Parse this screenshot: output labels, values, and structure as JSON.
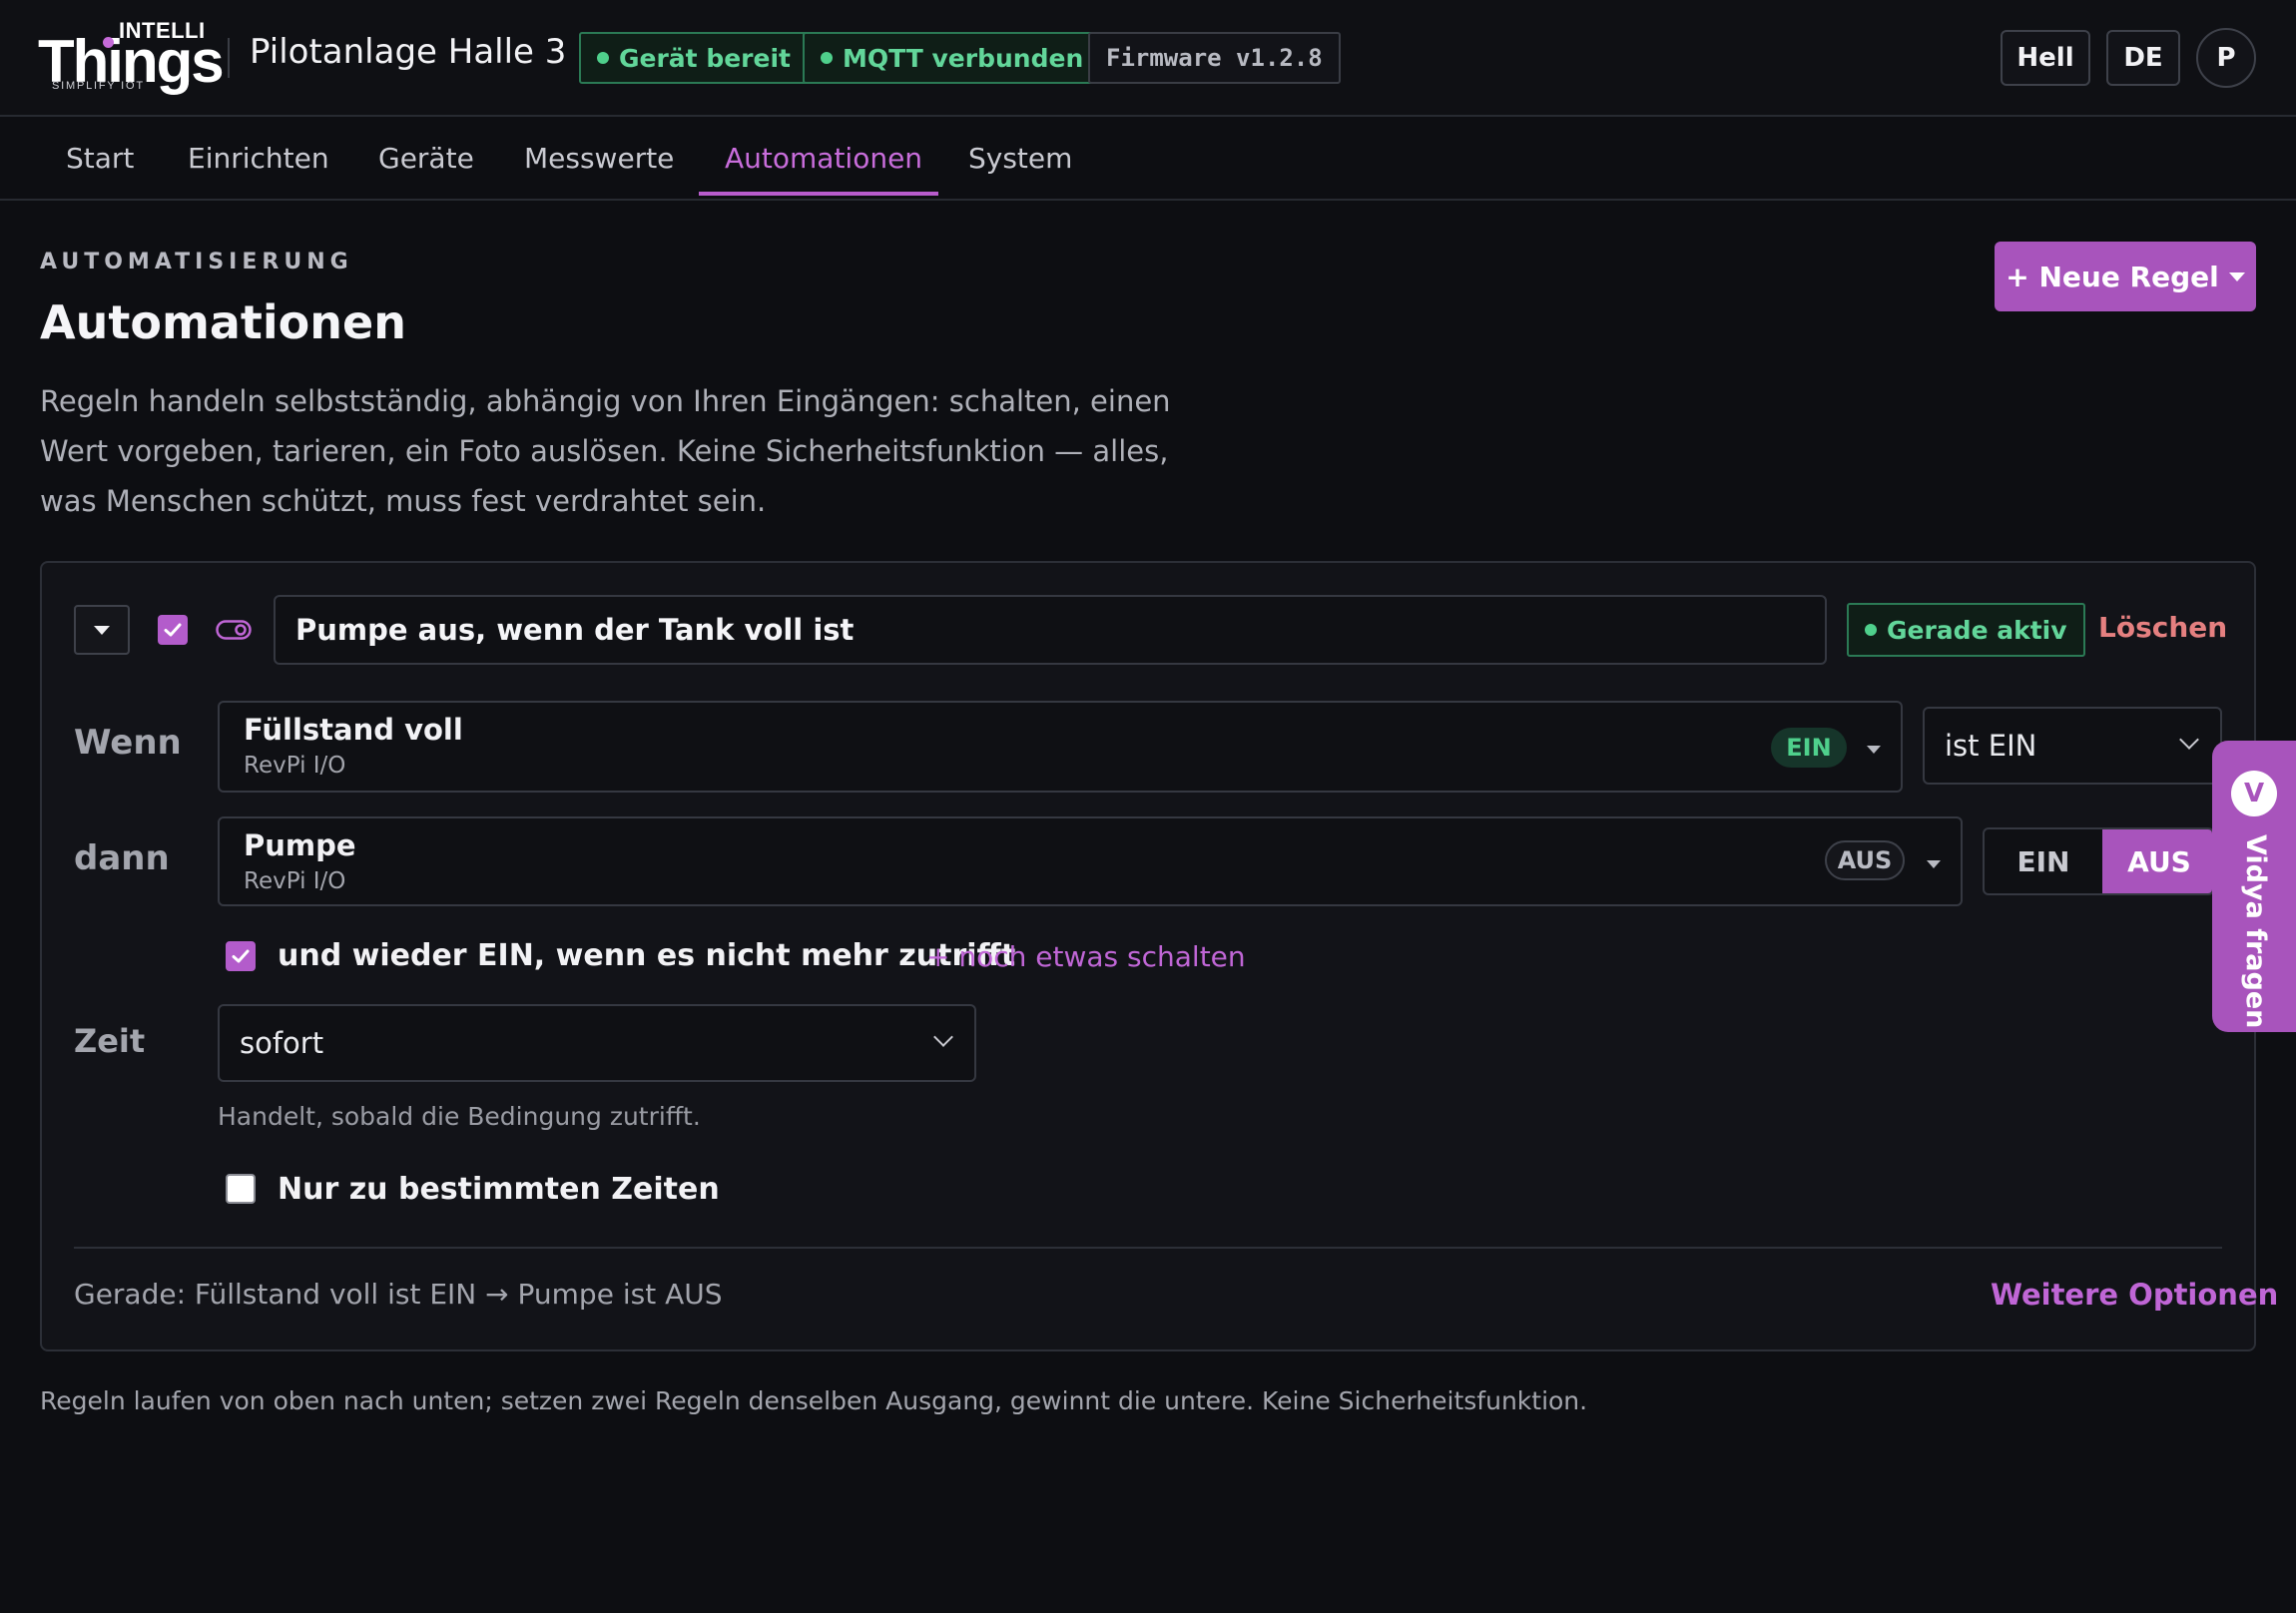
{
  "header": {
    "logo": {
      "top": "INTELLI",
      "main": "Things",
      "tagline": "SIMPLIFY IOT"
    },
    "site_name": "Pilotanlage Halle 3",
    "status_device": "Gerät bereit",
    "status_mqtt": "MQTT verbunden",
    "firmware": "Firmware v1.2.8",
    "theme_label": "Hell",
    "lang_label": "DE",
    "user_initial": "P"
  },
  "nav": {
    "tabs": [
      "Start",
      "Einrichten",
      "Geräte",
      "Messwerte",
      "Automationen",
      "System"
    ],
    "active": "Automationen"
  },
  "page": {
    "eyebrow": "AUTOMATISIERUNG",
    "title": "Automationen",
    "description": "Regeln handeln selbstständig, abhängig von Ihren Eingängen: schalten, einen Wert vorgeben, tarieren, ein Foto auslösen. Keine Sicherheitsfunktion — alles, was Menschen schützt, muss fest verdrahtet sein.",
    "new_rule_label": "+ Neue Regel"
  },
  "rule": {
    "enabled": true,
    "name": "Pumpe aus, wenn der Tank voll ist",
    "active_label": "Gerade aktiv",
    "delete_label": "Löschen",
    "when": {
      "label": "Wenn",
      "input_name": "Füllstand voll",
      "input_source": "RevPi I/O",
      "current_state": "EIN",
      "condition": "ist EIN"
    },
    "then": {
      "label": "dann",
      "output_name": "Pumpe",
      "output_source": "RevPi I/O",
      "current_state": "AUS",
      "options": [
        "EIN",
        "AUS"
      ],
      "selected": "AUS"
    },
    "revert": {
      "checked": true,
      "label": "und wieder EIN, wenn es nicht mehr zutrifft"
    },
    "add_action_label": "+ noch etwas schalten",
    "time": {
      "label": "Zeit",
      "value": "sofort",
      "hint": "Handelt, sobald die Bedingung zutrifft."
    },
    "schedule": {
      "checked": false,
      "label": "Nur zu bestimmten Zeiten"
    },
    "status_line": "Gerade: Füllstand voll ist EIN → Pumpe ist AUS",
    "more_options_label": "Weitere Optionen"
  },
  "footer_note": "Regeln laufen von oben nach unten; setzen zwei Regeln denselben Ausgang, gewinnt die untere. Keine Sicherheitsfunktion.",
  "assistant": {
    "badge": "V",
    "label": "Vidya fragen"
  },
  "colors": {
    "accent": "#a854bc",
    "success": "#4fd08c",
    "danger": "#e58080",
    "background": "#0d0e12"
  }
}
